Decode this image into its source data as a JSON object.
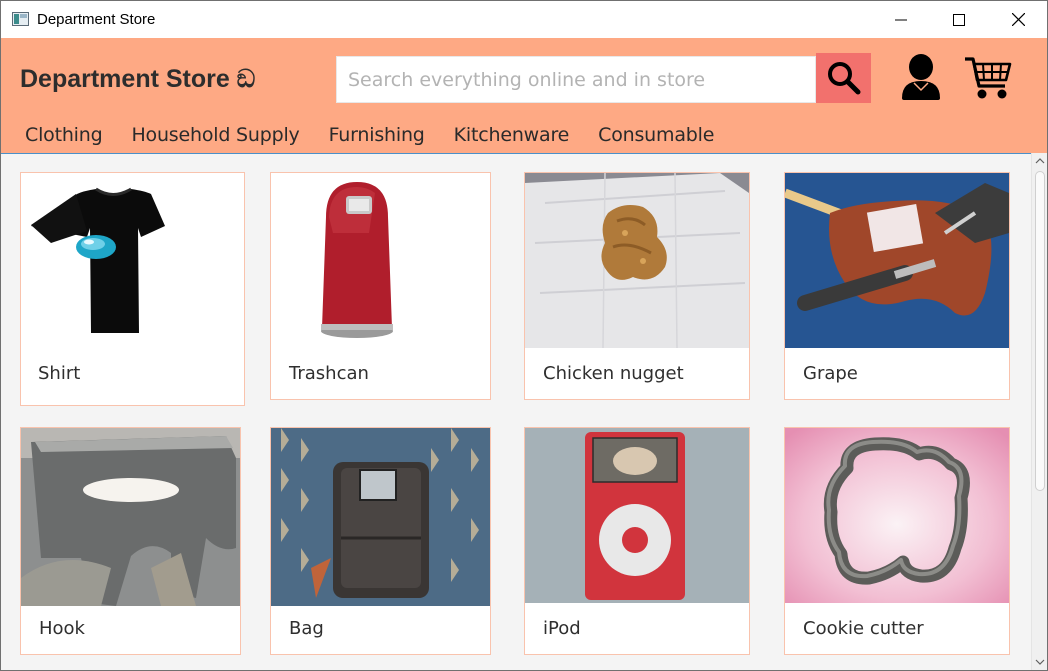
{
  "window": {
    "title": "Department Store",
    "icon": "window-app-icon",
    "controls": [
      "minimize-icon",
      "maximize-icon",
      "close-icon"
    ]
  },
  "header": {
    "brand": "Department Store ඞ",
    "search_placeholder": "Search everything online and in store",
    "search_value": "",
    "icons": [
      "search-icon",
      "user-icon",
      "cart-icon"
    ],
    "background_color": "#fea984",
    "search_button_color": "#f2716d"
  },
  "nav": {
    "items": [
      {
        "label": "Clothing"
      },
      {
        "label": "Household Supply"
      },
      {
        "label": "Furnishing"
      },
      {
        "label": "Kitchenware"
      },
      {
        "label": "Consumable"
      }
    ]
  },
  "products": [
    {
      "label": "Shirt"
    },
    {
      "label": "Trashcan"
    },
    {
      "label": "Chicken nugget"
    },
    {
      "label": "Grape"
    },
    {
      "label": "Hook"
    },
    {
      "label": "Bag"
    },
    {
      "label": "iPod"
    },
    {
      "label": "Cookie cutter"
    }
  ]
}
